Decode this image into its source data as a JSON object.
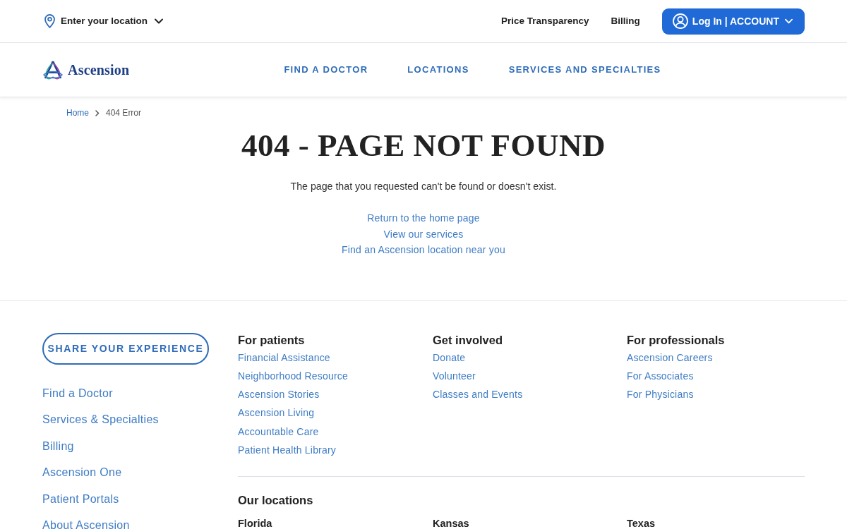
{
  "top_bar": {
    "location": {
      "label": "Enter your location"
    },
    "links": [
      "Price Transparency",
      "Billing"
    ],
    "account_button": {
      "label": "Log In | ACCOUNT"
    }
  },
  "header": {
    "logo": {
      "text": "Ascension"
    },
    "nav": [
      "FIND A DOCTOR",
      "LOCATIONS",
      "SERVICES AND SPECIALTIES"
    ]
  },
  "breadcrumb": {
    "links": [
      "Home"
    ],
    "current": "404 Error"
  },
  "error": {
    "title": "404 - PAGE NOT FOUND",
    "message": "The page that you requested can't be found or doesn't exist.",
    "links": [
      "Return to the home page",
      "View our services",
      "Find an Ascension location near you"
    ]
  },
  "footer": {
    "share_button": "SHARE YOUR EXPERIENCE",
    "links": [
      "Find a Doctor",
      "Services & Specialties",
      "Billing",
      "Ascension One",
      "Patient Portals",
      "About Ascension"
    ],
    "columns": [
      {
        "heading": "For patients",
        "links": [
          "Financial Assistance",
          "Neighborhood Resource",
          "Ascension Stories",
          "Ascension Living",
          "Accountable Care",
          "Patient Health Library"
        ]
      },
      {
        "heading": "Get involved",
        "links": [
          "Donate",
          "Volunteer",
          "Classes and Events"
        ]
      },
      {
        "heading": "For professionals",
        "links": [
          "Ascension Careers",
          "For Associates",
          "For Physicians"
        ]
      }
    ],
    "locations": {
      "heading": "Our locations",
      "states": [
        "Florida",
        "Kansas",
        "Texas"
      ]
    }
  }
}
